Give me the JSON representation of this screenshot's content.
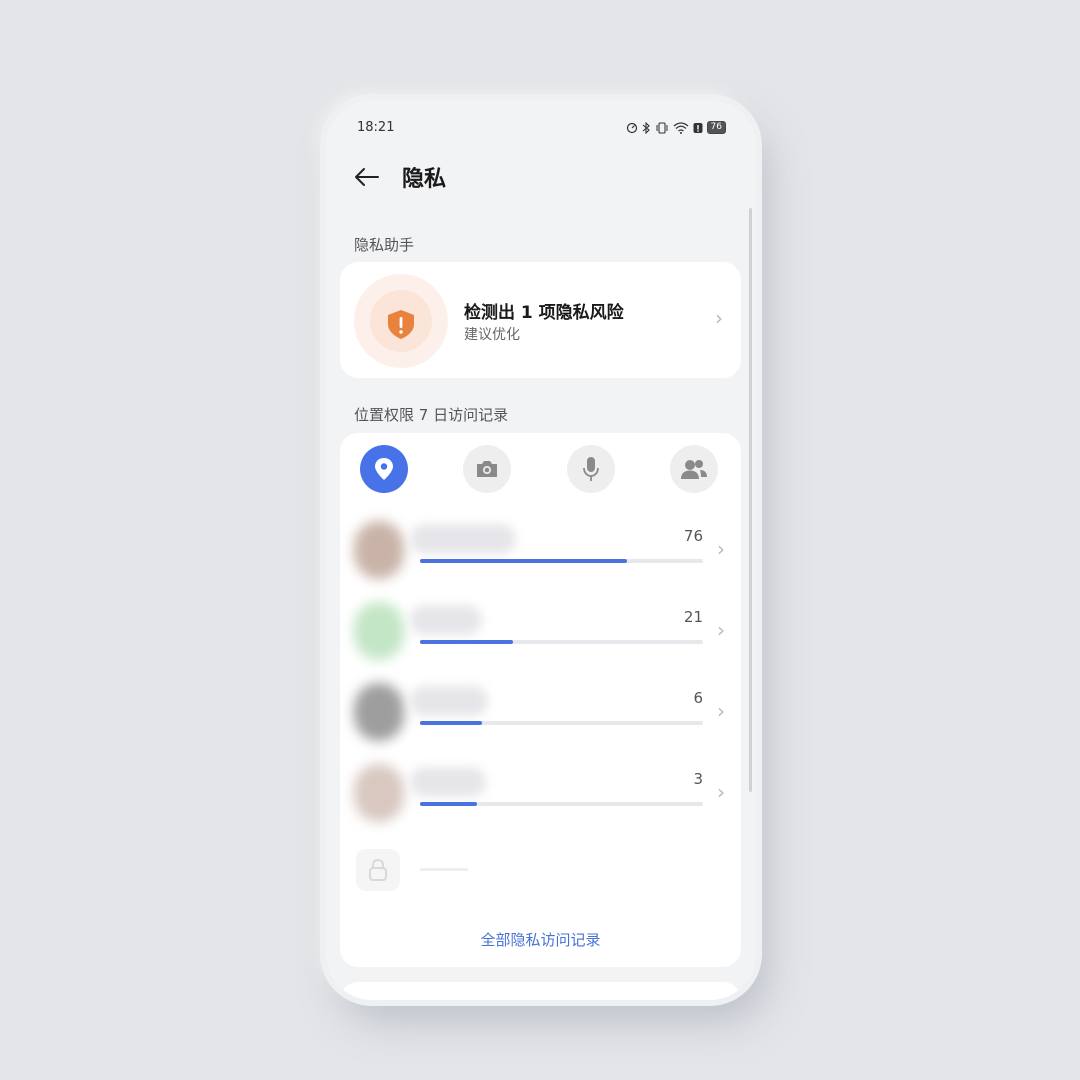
{
  "status_bar": {
    "time": "18:21",
    "battery": "76"
  },
  "header": {
    "title": "隐私"
  },
  "privacy_assistant": {
    "section_label": "隐私助手",
    "title": "检测出 1 项隐私风险",
    "subtitle": "建议优化"
  },
  "permission_log": {
    "section_label": "位置权限 7 日访问记录",
    "tabs": [
      {
        "icon": "location-icon",
        "active": true
      },
      {
        "icon": "camera-icon",
        "active": false
      },
      {
        "icon": "microphone-icon",
        "active": false
      },
      {
        "icon": "contacts-icon",
        "active": false
      }
    ],
    "rows": [
      {
        "count": "76",
        "fraction": 0.73
      },
      {
        "count": "21",
        "fraction": 0.33
      },
      {
        "count": "6",
        "fraction": 0.22
      },
      {
        "count": "3",
        "fraction": 0.2
      }
    ],
    "all_records_link": "全部隐私访问记录"
  },
  "colors": {
    "accent": "#4872e8",
    "warning": "#e8823c",
    "background": "#f2f3f5"
  }
}
